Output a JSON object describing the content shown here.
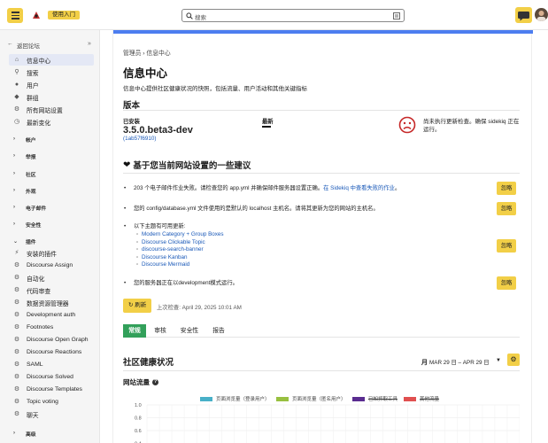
{
  "header": {
    "home_button": "使用入门",
    "search_placeholder": "搜索"
  },
  "sidebar": {
    "back_label": "返回论坛",
    "items": [
      {
        "label": "信息中心",
        "icon": "home-icon",
        "active": true
      },
      {
        "label": "搜索",
        "icon": "search-icon"
      },
      {
        "label": "用户",
        "icon": "user-icon"
      },
      {
        "label": "群组",
        "icon": "group-icon"
      },
      {
        "label": "所有网站设置",
        "icon": "gear-icon"
      },
      {
        "label": "最新变化",
        "icon": "clock-icon"
      }
    ],
    "sections": [
      "帐户",
      "举报",
      "社区",
      "外观",
      "电子邮件",
      "安全性",
      "插件",
      "高级"
    ],
    "plugins": [
      {
        "label": "安装的插件",
        "icon": "plug-icon"
      },
      {
        "label": "Discourse Assign",
        "icon": "gear-icon"
      },
      {
        "label": "自动化",
        "icon": "gear-icon"
      },
      {
        "label": "代码审查",
        "icon": "gear-icon"
      },
      {
        "label": "数据资源管理器",
        "icon": "gear-icon"
      },
      {
        "label": "Development auth",
        "icon": "gear-icon"
      },
      {
        "label": "Footnotes",
        "icon": "gear-icon"
      },
      {
        "label": "Discourse Open Graph",
        "icon": "gear-icon"
      },
      {
        "label": "Discourse Reactions",
        "icon": "gear-icon"
      },
      {
        "label": "SAML",
        "icon": "gear-icon"
      },
      {
        "label": "Discourse Solved",
        "icon": "gear-icon"
      },
      {
        "label": "Discourse Templates",
        "icon": "gear-icon"
      },
      {
        "label": "Topic voting",
        "icon": "gear-icon"
      },
      {
        "label": "聊天",
        "icon": "gear-icon"
      }
    ]
  },
  "main": {
    "breadcrumb": "管理员 › 信息中心",
    "title": "信息中心",
    "description": "信息中心提供社区健康状况的快照，包括流量、用户活动和其他关键指标",
    "version": {
      "heading": "版本",
      "installed_label": "已安装",
      "installed_value": "3.5.0.beta3-dev",
      "commit": "(1ab57f6910)",
      "latest_label": "最新",
      "update_status": "尚未执行更新检查。确保 sidekiq 正在运行。"
    },
    "suggestions": {
      "heading": "基于您当前网站设置的一些建议",
      "ignore_label": "忽略",
      "item1_text": "203 个电子邮件作业失败。请检查您的 app.yml 并确保邮件服务器设置正确。",
      "item1_link": "在 Sidekiq 中查看失败的作业",
      "item1_end": "。",
      "item2": "您的 config/database.yml 文件使用的是默认的 localhost 主机名。请将其更新为您的网站的主机名。",
      "item3": "以下主题有可用更新:",
      "themes": [
        "Modern Category + Group Boxes",
        "Discourse Clickable Topic",
        "discourse-search-banner",
        "Discourse Kanban",
        "Discourse Mermaid"
      ],
      "item4": "您的服务器正在以development模式运行。"
    },
    "refresh_label": "刷新",
    "last_checked": "上次检查: April 29, 2025 10:01 AM",
    "tabs": [
      "常规",
      "审核",
      "安全性",
      "报告"
    ],
    "health": {
      "heading": "社区健康状况",
      "range": "MAR 29 日 – APR 29 日"
    },
    "traffic_heading": "网站流量"
  },
  "chart_data": {
    "type": "bar",
    "title": "网站流量",
    "series": [
      {
        "name": "页面浏览量（登录用户）",
        "color": "#48b0c8"
      },
      {
        "name": "页面浏览量（匿名用户）",
        "color": "#98c040"
      },
      {
        "name": "已知抓取工具",
        "color": "#5a2c90"
      },
      {
        "name": "其他流量",
        "color": "#e05050"
      }
    ],
    "yticks": [
      "1.0",
      "0.8",
      "0.6",
      "0.4"
    ],
    "ylim": [
      0,
      1.0
    ]
  }
}
